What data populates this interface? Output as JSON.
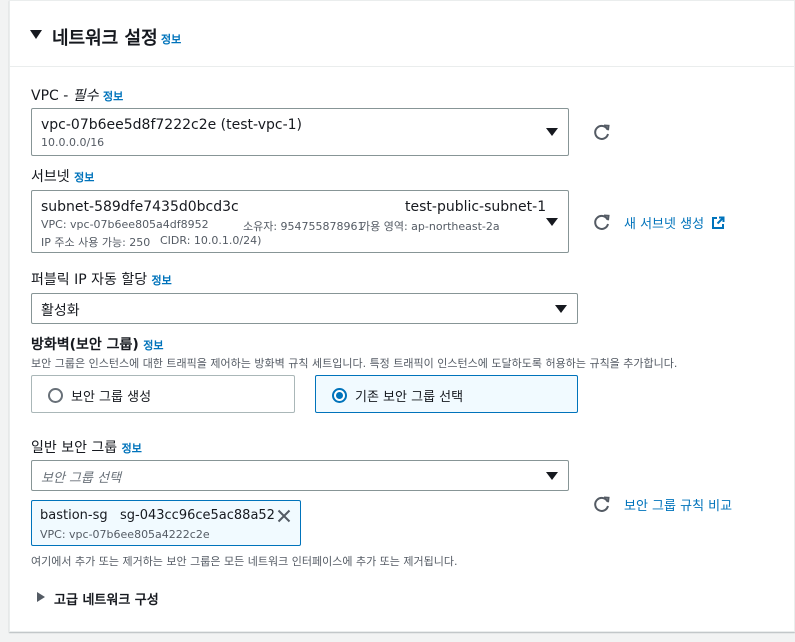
{
  "header": {
    "title": "네트워크 설정",
    "info": "정보"
  },
  "vpc": {
    "label": "VPC - ",
    "required": "필수",
    "info": "정보",
    "value": "vpc-07b6ee5d8f7222c2e (test-vpc-1)",
    "cidr": "10.0.0.0/16"
  },
  "subnet": {
    "label": "서브넷",
    "info": "정보",
    "id": "subnet-589dfe7435d0bcd3c",
    "name": "test-public-subnet-1",
    "vpc": "VPC: vpc-07b6ee805a4df8952",
    "owner": "소유자: 954755878961",
    "az": "가용 영역: ap-northeast-2a",
    "ips": "IP 주소 사용 가능: 250",
    "cidr": "CIDR: 10.0.1.0/24)",
    "create_link": "새 서브넷 생성"
  },
  "public_ip": {
    "label": "퍼블릭 IP 자동 할당",
    "info": "정보",
    "value": "활성화"
  },
  "firewall": {
    "label": "방화벽(보안 그룹)",
    "info": "정보",
    "description": "보안 그룹은 인스턴스에 대한 트래픽을 제어하는 방화벽 규칙 세트입니다. 특정 트래픽이 인스턴스에 도달하도록 허용하는 규칙을 추가합니다.",
    "option_create": "보안 그룹 생성",
    "option_existing": "기존 보안 그룹 선택"
  },
  "sg": {
    "label": "일반 보안 그룹",
    "info": "정보",
    "placeholder": "보안 그룹 선택",
    "token_name": "bastion-sg",
    "token_id": "sg-043cc96ce5ac88a52",
    "token_vpc": "VPC: vpc-07b6ee805a4222c2e",
    "compare_link": "보안 그룹 규칙 비교",
    "note": "여기에서 추가 또는 제거하는 보안 그룹은 모든 네트워크 인터페이스에 추가 또는 제거됩니다."
  },
  "advanced": {
    "label": "고급 네트워크 구성"
  }
}
